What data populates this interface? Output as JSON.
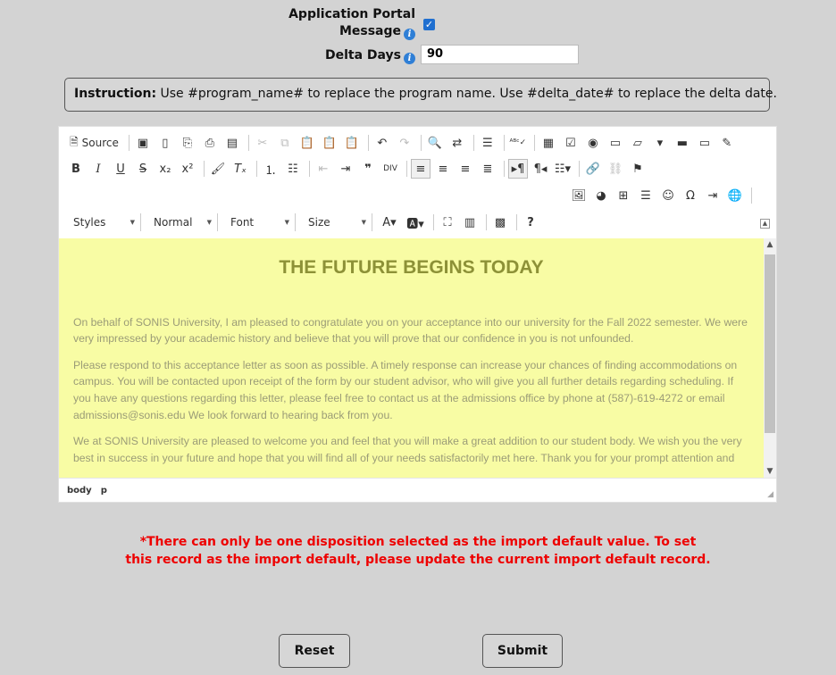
{
  "form": {
    "portal_label_line1": "Application Portal",
    "portal_label_line2": "Message",
    "portal_checked": true,
    "delta_label": "Delta Days",
    "delta_value": "90",
    "info_glyph": "i"
  },
  "instruction": {
    "prefix": "Instruction:",
    "text": " Use #program_name# to replace the program name. Use #delta_date# to replace the delta date."
  },
  "editor": {
    "source_label": "Source",
    "combos": {
      "styles": "Styles",
      "format": "Normal",
      "font": "Font",
      "size": "Size"
    },
    "content": {
      "title": "THE FUTURE BEGINS TODAY",
      "paragraphs": [
        "On behalf of SONIS University, I am pleased to congratulate you on your acceptance into our university for the Fall 2022 semester. We were very impressed by your academic history and believe that you will prove that our confidence in you is not unfounded.",
        "Please respond to this acceptance letter as soon as possible. A timely response can increase your chances of finding accommodations on campus. You will be contacted upon receipt of the form by our student advisor, who will give you all further details regarding scheduling. If you have any questions regarding this letter, please feel free to contact us at the admissions office by phone at (587)-619-4272 or email admissions@sonis.edu We look forward to hearing back from you.",
        "We at SONIS University are pleased to welcome you and feel that you will make a great addition to our student body. We wish you the very best in success in your future and hope that you will find all of your needs satisfactorily met here. Thank you for your prompt attention and"
      ]
    },
    "status_path": [
      "body",
      "p"
    ],
    "colors": {
      "content_bg": "#f8fca4",
      "title": "#8d9137",
      "body_text": "#9b9c77"
    }
  },
  "warning": {
    "line1": "*There can only be one disposition selected as the import default value. To set",
    "line2": "this record as the import default, please update the current import default record."
  },
  "buttons": {
    "reset": "Reset",
    "submit": "Submit"
  }
}
